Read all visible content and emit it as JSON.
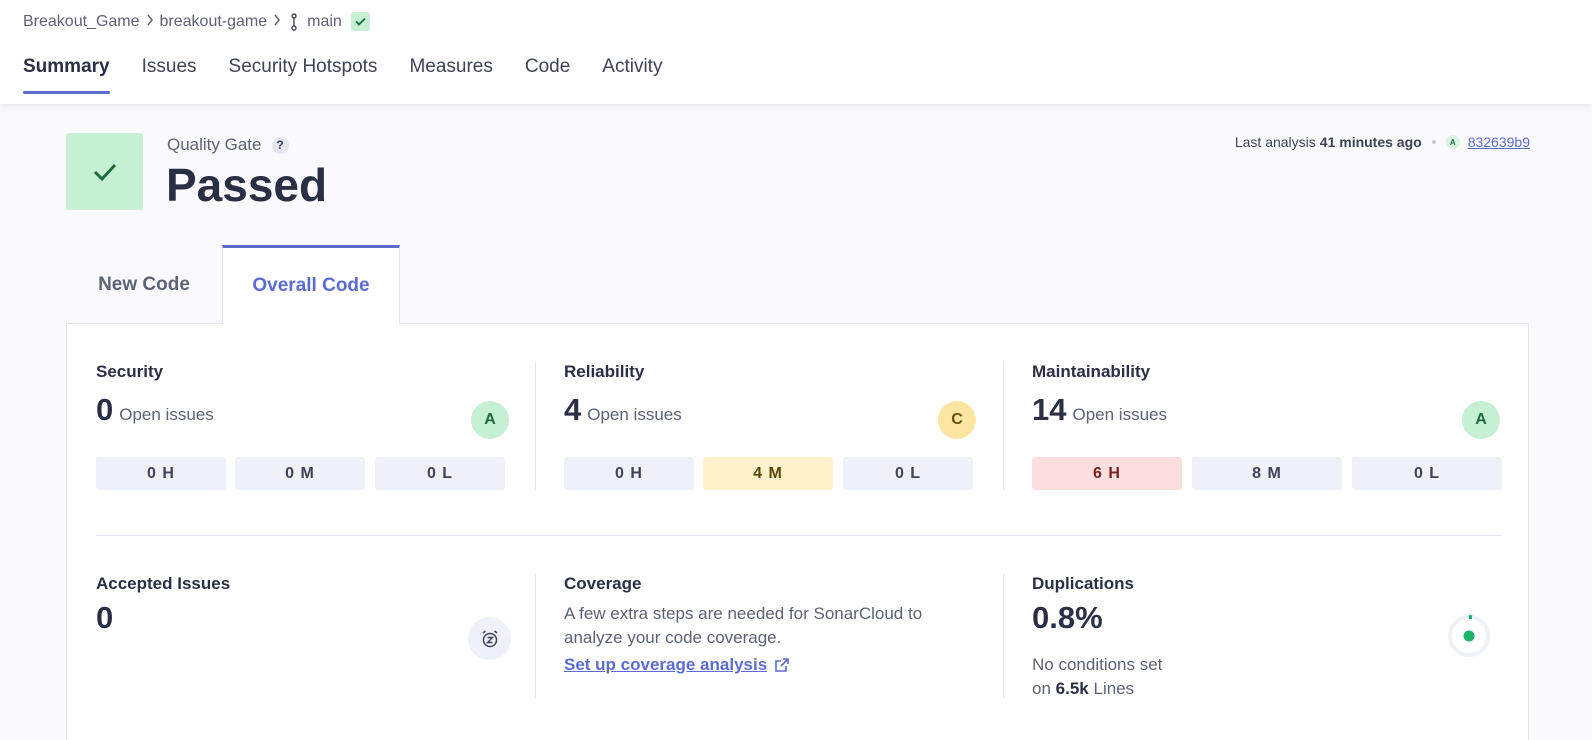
{
  "breadcrumb": {
    "org": "Breakout_Game",
    "project": "breakout-game",
    "branch": "main"
  },
  "nav": {
    "tabs": [
      "Summary",
      "Issues",
      "Security Hotspots",
      "Measures",
      "Code",
      "Activity"
    ],
    "active": "Summary"
  },
  "quality_gate": {
    "label": "Quality Gate",
    "help": "?",
    "status": "Passed"
  },
  "last_analysis": {
    "prefix": "Last analysis",
    "time": "41 minutes ago",
    "grade": "A",
    "commit": "832639b9"
  },
  "code_tabs": {
    "new_code": "New Code",
    "overall_code": "Overall Code",
    "active": "Overall Code"
  },
  "metrics": {
    "security": {
      "title": "Security",
      "count": "0",
      "label": "Open issues",
      "grade": "A",
      "severities": [
        "0 H",
        "0 M",
        "0 L"
      ]
    },
    "reliability": {
      "title": "Reliability",
      "count": "4",
      "label": "Open issues",
      "grade": "C",
      "severities": [
        "0 H",
        "4 M",
        "0 L"
      ]
    },
    "maintainability": {
      "title": "Maintainability",
      "count": "14",
      "label": "Open issues",
      "grade": "A",
      "severities": [
        "6 H",
        "8 M",
        "0 L"
      ]
    },
    "accepted": {
      "title": "Accepted Issues",
      "count": "0"
    },
    "coverage": {
      "title": "Coverage",
      "description": "A few extra steps are needed for SonarCloud to analyze your code coverage.",
      "link": "Set up coverage analysis"
    },
    "duplications": {
      "title": "Duplications",
      "value": "0.8%",
      "note_line1": "No conditions set",
      "note_prefix": "on",
      "lines": "6.5k",
      "note_suffix": "Lines"
    }
  },
  "colors": {
    "accent": "#5d6cd1",
    "passed_bg": "#c6f0d4",
    "passed_icon": "#1f6b3a"
  }
}
